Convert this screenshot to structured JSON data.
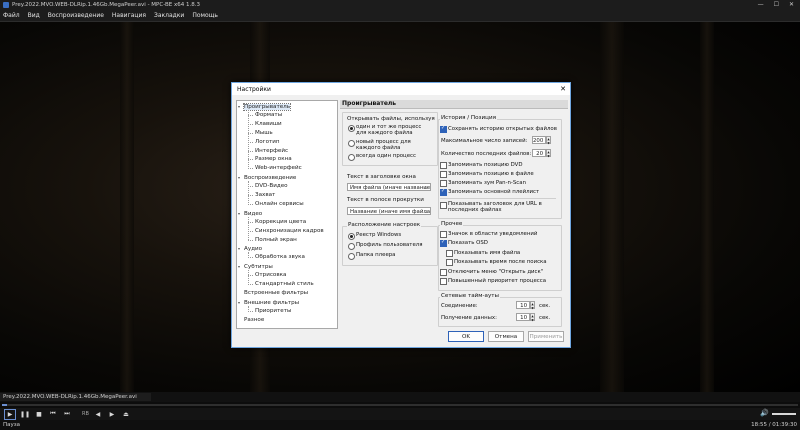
{
  "window": {
    "title": "Prey.2022.MVO.WEB-DLRip.1.46Gb.MegaPeer.avi - MPC-BE x64 1.8.3"
  },
  "menu": [
    "Файл",
    "Вид",
    "Воспроизведение",
    "Навигация",
    "Закладки",
    "Помощь"
  ],
  "player": {
    "filename": "Prey.2022.MVO.WEB-DLRip.1.46Gb.MegaPeer.avi",
    "status": "Пауза",
    "time": "18:55 / 01:39:30",
    "ctrl_label": "RB",
    "seek_progress_percent": 0.6,
    "volume_percent": 100
  },
  "dialog": {
    "title": "Настройки",
    "tree": [
      {
        "label": "Проигрыватель",
        "level": 0,
        "expander": "−",
        "selected": true
      },
      {
        "label": "Форматы",
        "level": 1
      },
      {
        "label": "Клавиши",
        "level": 1
      },
      {
        "label": "Мышь",
        "level": 1
      },
      {
        "label": "Логотип",
        "level": 1
      },
      {
        "label": "Интерфейс",
        "level": 1
      },
      {
        "label": "Размер окна",
        "level": 1
      },
      {
        "label": "Web-интерфейс",
        "level": 1
      },
      {
        "label": "Воспроизведение",
        "level": 0,
        "expander": "−"
      },
      {
        "label": "DVD-Видео",
        "level": 1
      },
      {
        "label": "Захват",
        "level": 1
      },
      {
        "label": "Онлайн сервисы",
        "level": 1
      },
      {
        "label": "Видео",
        "level": 0,
        "expander": "−"
      },
      {
        "label": "Коррекция цвета",
        "level": 1
      },
      {
        "label": "Синхронизация кадров",
        "level": 1
      },
      {
        "label": "Полный экран",
        "level": 1
      },
      {
        "label": "Аудио",
        "level": 0,
        "expander": "−"
      },
      {
        "label": "Обработка звука",
        "level": 1
      },
      {
        "label": "Субтитры",
        "level": 0,
        "expander": "−"
      },
      {
        "label": "Отрисовка",
        "level": 1
      },
      {
        "label": "Стандартный стиль",
        "level": 1
      },
      {
        "label": "Встроенные фильтры",
        "level": 0
      },
      {
        "label": "Внешние фильтры",
        "level": 0,
        "expander": "−"
      },
      {
        "label": "Приоритеты",
        "level": 1
      },
      {
        "label": "Разное",
        "level": 0
      }
    ],
    "page_header": "Проигрыватель",
    "open_files": {
      "label": "Открывать файлы, используя",
      "options": [
        "один и тот же процесс для каждого файла",
        "новый процесс для каждого файла",
        "всегда один процесс"
      ],
      "selected": 0
    },
    "title_text": {
      "label": "Текст в заголовке окна",
      "value": "Имя файла (иначе название"
    },
    "seekbar_text": {
      "label": "Текст в полосе прокрутки",
      "value": "Название (иначе имя файла"
    },
    "settings_location": {
      "label": "Расположение настроек",
      "options": [
        "Реестр Windows",
        "Профиль пользователя",
        "Папка плеера"
      ],
      "selected": 0
    },
    "history": {
      "label": "История / Позиция",
      "save_history": "Сохранять историю открытых файлов",
      "max_records_label": "Максимальное число записей:",
      "max_records": "200",
      "recent_files_label": "Количество последних файлов:",
      "recent_files": "20",
      "checks": [
        {
          "label": "Запоминать позицию DVD",
          "checked": false
        },
        {
          "label": "Запоминать позицию в файле",
          "checked": false
        },
        {
          "label": "Запоминать зум Pan-n-Scan",
          "checked": false
        },
        {
          "label": "Запоминать основной плейлист",
          "checked": true
        }
      ],
      "url_title": "Показывать заголовок для URL в последних файлах"
    },
    "other": {
      "label": "Прочее",
      "tray": "Значок в области уведомлений",
      "osd": "Показать OSD",
      "osd_filename": "Показывать имя файла",
      "osd_seektime": "Показывать время после поиска",
      "disable_open_disc": "Отключить меню \"Открыть диск\"",
      "high_priority": "Повышенный приоритет процесса"
    },
    "network": {
      "label": "Сетевые тайм-ауты",
      "connection_label": "Соединение:",
      "connection": "10",
      "data_label": "Получение данных:",
      "data": "10",
      "unit": "сек."
    },
    "buttons": {
      "ok": "OK",
      "cancel": "Отмена",
      "apply": "Применить"
    }
  }
}
